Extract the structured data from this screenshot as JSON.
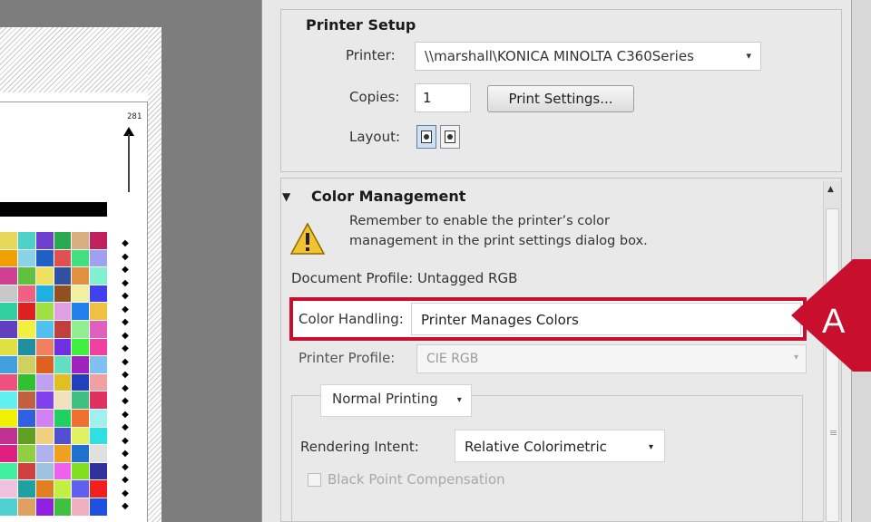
{
  "preview": {
    "page_width_label": "281",
    "registration_mark": "◆",
    "swatch_colors": [
      "#e8d85a",
      "#4bd1c8",
      "#6f3fd0",
      "#28a850",
      "#d8b080",
      "#c02060",
      "#f0a000",
      "#8ad2e6",
      "#1e60c8",
      "#e05050",
      "#40e080",
      "#a0a0f0",
      "#d04090",
      "#60c040",
      "#f0e060",
      "#3050a0",
      "#e09040",
      "#80f0d0",
      "#c8c8c8",
      "#f06080",
      "#20b0e0",
      "#905020",
      "#f0f0a0",
      "#4040f0",
      "#30d0a0",
      "#e02020",
      "#a0e040",
      "#e0a0e0",
      "#2080f0",
      "#f0c040",
      "#6040c0",
      "#f0f040",
      "#50c0f0",
      "#c04040",
      "#90f090",
      "#e060c0",
      "#e0e040",
      "#2090a0",
      "#f08060",
      "#7030e0",
      "#40f040",
      "#f040a0",
      "#40a0e0",
      "#d0d060",
      "#e06020",
      "#60e0c0",
      "#a020c0",
      "#80c0f0",
      "#f05080",
      "#30c030",
      "#c0a0f0",
      "#e0c020",
      "#2040c0",
      "#f0a0a0",
      "#60f0f0",
      "#c06040",
      "#8040f0",
      "#f0e0c0",
      "#40c080",
      "#e03060",
      "#f0f000",
      "#3060e0",
      "#d080f0",
      "#20d060",
      "#f07030",
      "#a0f0f0",
      "#c03090",
      "#60a020",
      "#f0d080",
      "#5050d0",
      "#e0f060",
      "#30e0e0",
      "#e02080",
      "#90d040",
      "#b0b0f0",
      "#f0a020",
      "#2070d0",
      "#e0e0e0",
      "#40f0a0",
      "#d04040",
      "#a0c0e0",
      "#f060f0",
      "#80e020",
      "#3030a0",
      "#f0c0e0",
      "#20a0a0",
      "#e08020",
      "#c0f040",
      "#6060f0",
      "#f02020",
      "#50d0d0",
      "#e0a060",
      "#9020e0",
      "#40c040",
      "#f0b0c0",
      "#2050e0"
    ]
  },
  "printer_setup": {
    "title": "Printer Setup",
    "printer_label": "Printer:",
    "printer_value": "\\\\marshall\\KONICA MINOLTA C360Series",
    "copies_label": "Copies:",
    "copies_value": "1",
    "print_settings_button": "Print Settings...",
    "layout_label": "Layout:",
    "layout_options": [
      "portrait",
      "landscape"
    ],
    "layout_selected": "portrait"
  },
  "color_management": {
    "expand_glyph": "▼",
    "title": "Color Management",
    "warning_line1": "Remember to enable the printer’s color",
    "warning_line2": "management in the print settings dialog box.",
    "document_profile": "Document Profile: Untagged RGB",
    "color_handling_label": "Color Handling:",
    "color_handling_value": "Printer Manages Colors",
    "printer_profile_label": "Printer Profile:",
    "printer_profile_value": "CIE RGB",
    "printing_mode": "Normal Printing",
    "rendering_intent_label": "Rendering Intent:",
    "rendering_intent_value": "Relative Colorimetric",
    "black_point_label": "Black Point Compensation",
    "black_point_checked": false
  },
  "callout": {
    "letter": "A",
    "color": "#c8102e"
  },
  "icons": {
    "dropdown_caret": "▾",
    "scroll_up": "▲",
    "scroll_grip": "≡"
  }
}
